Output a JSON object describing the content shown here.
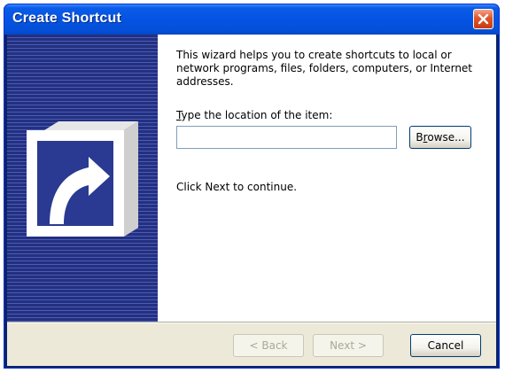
{
  "window": {
    "title": "Create Shortcut"
  },
  "content": {
    "intro": "This wizard helps you to create shortcuts to local or network programs, files, folders, computers, or Internet addresses.",
    "location_label_accel": "T",
    "location_label_rest": "ype the location of the item:",
    "location_value": "",
    "browse_accel": "r",
    "browse_pre": "B",
    "browse_post": "owse...",
    "next_message": "Click Next to continue."
  },
  "footer": {
    "back_label": "< Back",
    "next_label": "Next >",
    "cancel_label": "Cancel"
  },
  "icons": {
    "close": "close-icon",
    "banner": "shortcut-arrow-icon"
  },
  "colors": {
    "titlebar": "#0553e3",
    "banner": "#24307f",
    "dialog_bg": "#ece9d8",
    "close_button": "#e0542a"
  }
}
